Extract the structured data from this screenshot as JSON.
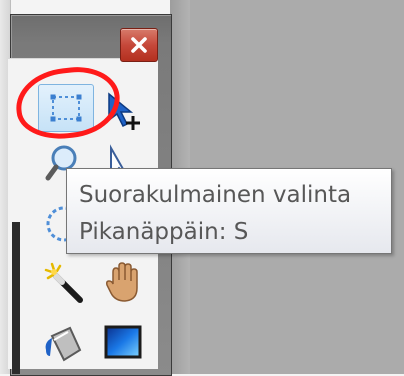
{
  "tools_window": {
    "close_icon": "close-x-icon",
    "tools": [
      {
        "id": "rectangle-select",
        "icon": "rectangle-select-icon",
        "selected": true
      },
      {
        "id": "move-selection",
        "icon": "move-selection-icon",
        "selected": false
      },
      {
        "id": "zoom",
        "icon": "zoom-icon",
        "selected": false
      },
      {
        "id": "lasso-select",
        "icon": "lasso-select-icon",
        "selected": false
      },
      {
        "id": "ellipse-select",
        "icon": "ellipse-select-icon",
        "selected": false
      },
      {
        "id": "magic-wand",
        "icon": "magic-wand-icon",
        "selected": false
      },
      {
        "id": "pan",
        "icon": "hand-icon",
        "selected": false
      },
      {
        "id": "paint-bucket",
        "icon": "paint-bucket-icon",
        "selected": false
      },
      {
        "id": "gradient",
        "icon": "gradient-icon",
        "selected": false
      }
    ]
  },
  "tooltip": {
    "title": "Suorakulmainen valinta",
    "shortcut": "Pikanäppäin: S"
  },
  "colors": {
    "annotation": "#ff1a1a",
    "selected_tool_bg": "#cfe6f9",
    "close_button": "#c6483a"
  }
}
